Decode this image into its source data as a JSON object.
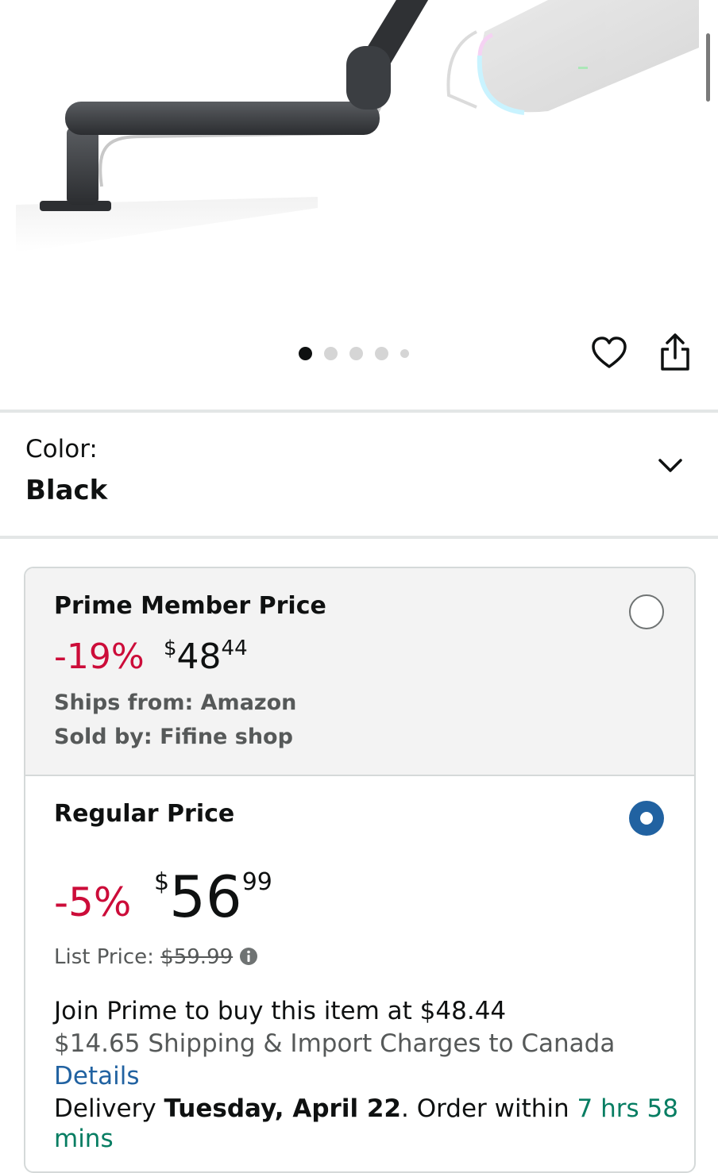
{
  "gallery": {
    "image_alt": "Black microphone boom arm clamped to desk with microphone",
    "dots": [
      {
        "active": true
      },
      {
        "active": false
      },
      {
        "active": false
      },
      {
        "active": false
      },
      {
        "active": false
      }
    ],
    "favorite_icon": "heart-icon",
    "share_icon": "share-icon"
  },
  "color": {
    "label": "Color:",
    "value": "Black",
    "expand_icon": "chevron-down-icon"
  },
  "offers": {
    "prime": {
      "title": "Prime Member Price",
      "discount": "-19%",
      "price_symbol": "$",
      "price_whole": "48",
      "price_fraction": "44",
      "ships_from": "Ships from: Amazon",
      "sold_by": "Sold by: Fifine shop",
      "selected": false
    },
    "regular": {
      "title": "Regular Price",
      "discount": "-5%",
      "price_symbol": "$",
      "price_whole": "56",
      "price_fraction": "99",
      "list_price_label": "List Price:",
      "list_price_value": "$59.99",
      "info_icon": "info-icon",
      "join_prime": "Join Prime to buy this item at $48.44",
      "shipping": "$14.65 Shipping & Import Charges to Canada",
      "details_link": "Details",
      "delivery_prefix": "Delivery ",
      "delivery_date": "Tuesday, April 22",
      "delivery_middle": ". Order within ",
      "countdown": "7 hrs 58",
      "countdown_cont": "mins",
      "selected": true
    }
  },
  "colors": {
    "discount_red": "#cc0c39",
    "link_blue": "#2162a1",
    "radio_selected": "#2162a1",
    "countdown_green": "#067d62",
    "card_gray": "#f3f3f3"
  }
}
